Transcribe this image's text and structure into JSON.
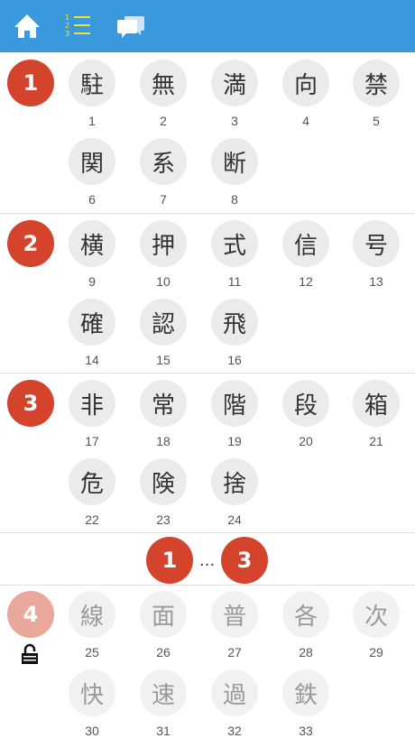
{
  "nav": {
    "icons": [
      "home-icon",
      "numbered-list-icon",
      "chat-icon"
    ]
  },
  "colors": {
    "header": "#3a98dd",
    "badge": "#d4432c",
    "badge_locked": "#eaa89c"
  },
  "lessons": [
    {
      "number": "1",
      "locked": false,
      "kanji": [
        {
          "char": "駐",
          "num": "1"
        },
        {
          "char": "無",
          "num": "2"
        },
        {
          "char": "満",
          "num": "3"
        },
        {
          "char": "向",
          "num": "4"
        },
        {
          "char": "禁",
          "num": "5"
        },
        {
          "char": "関",
          "num": "6"
        },
        {
          "char": "系",
          "num": "7"
        },
        {
          "char": "断",
          "num": "8"
        }
      ]
    },
    {
      "number": "2",
      "locked": false,
      "kanji": [
        {
          "char": "横",
          "num": "9"
        },
        {
          "char": "押",
          "num": "10"
        },
        {
          "char": "式",
          "num": "11"
        },
        {
          "char": "信",
          "num": "12"
        },
        {
          "char": "号",
          "num": "13"
        },
        {
          "char": "確",
          "num": "14"
        },
        {
          "char": "認",
          "num": "15"
        },
        {
          "char": "飛",
          "num": "16"
        }
      ]
    },
    {
      "number": "3",
      "locked": false,
      "kanji": [
        {
          "char": "非",
          "num": "17"
        },
        {
          "char": "常",
          "num": "18"
        },
        {
          "char": "階",
          "num": "19"
        },
        {
          "char": "段",
          "num": "20"
        },
        {
          "char": "箱",
          "num": "21"
        },
        {
          "char": "危",
          "num": "22"
        },
        {
          "char": "険",
          "num": "23"
        },
        {
          "char": "捨",
          "num": "24"
        }
      ]
    },
    {
      "number": "4",
      "locked": true,
      "kanji": [
        {
          "char": "線",
          "num": "25"
        },
        {
          "char": "面",
          "num": "26"
        },
        {
          "char": "普",
          "num": "27"
        },
        {
          "char": "各",
          "num": "28"
        },
        {
          "char": "次",
          "num": "29"
        },
        {
          "char": "快",
          "num": "30"
        },
        {
          "char": "速",
          "num": "31"
        },
        {
          "char": "過",
          "num": "32"
        },
        {
          "char": "鉄",
          "num": "33"
        }
      ]
    }
  ],
  "review": {
    "start": "1",
    "separator": "...",
    "end": "3"
  }
}
